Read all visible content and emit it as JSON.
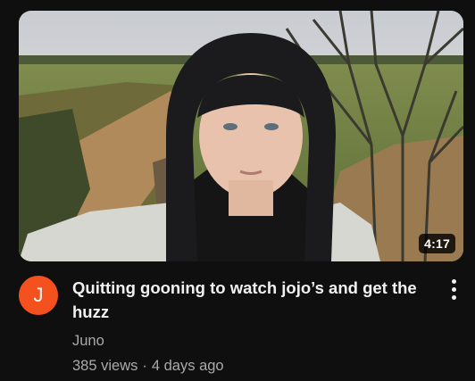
{
  "video": {
    "duration": "4:17",
    "title": "Quitting gooning to watch jojo’s and get the huzz",
    "channel": "Juno",
    "views": "385 views",
    "separator": "·",
    "uploaded": "4 days ago"
  },
  "avatar": {
    "letter": "J",
    "color": "#f4511e"
  },
  "icons": {
    "menu": "more-vertical-icon"
  }
}
